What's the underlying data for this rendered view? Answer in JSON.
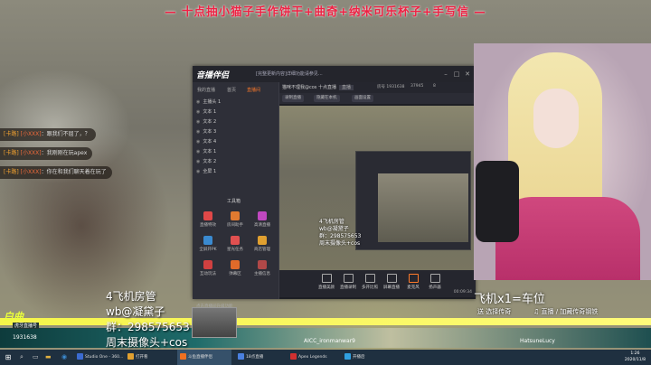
{
  "banner": "— 十点抽小猫子手作饼干+曲奇+纳米可乐杯子+手写信 —",
  "chat": [
    {
      "level": "[卡路]",
      "user": "[小XXX]",
      "sep": "：",
      "msg": "跟我们不屈了，？"
    },
    {
      "level": "[卡路]",
      "user": "[小XXX]",
      "sep": "：",
      "msg": "我刚刚在玩apex"
    },
    {
      "level": "[卡路]",
      "user": "[小XXX]",
      "sep": "：",
      "msg": "你在和我们聊天着在玩了"
    }
  ],
  "window": {
    "logo": "音播伴侣",
    "notice": "[完整更新内容]详细功能请参见...",
    "tabs": [
      "我的直播",
      "首页",
      "直播间"
    ],
    "sources": [
      "主播头 1",
      "文本 1",
      "文本 2",
      "文本 3",
      "文本 4",
      "文本 1",
      "文本 2",
      "全屏 1"
    ],
    "tools_title": "工具箱",
    "tools": [
      "直播特效",
      "房间助手",
      "高清直播",
      "全屏开PK",
      "星光任务",
      "商店管理",
      "互动玩法",
      "弹幕区",
      "主播信息"
    ],
    "bottom_notice": "点击直播间升级功能",
    "info": {
      "title": "猫咪不理我@cos 十点直播",
      "badge": "直播",
      "room": "房号 1931638",
      "fans": "37945",
      "likes": "8"
    },
    "sub_buttons": [
      "录制直播",
      "隐藏在本机",
      "画面设置"
    ],
    "controls": [
      "直播美颜",
      "直播录制",
      "多开比照",
      "屏幕直播",
      "麦克风",
      "扬声器"
    ],
    "status_time": "00:09:34",
    "status_fps": "30fps"
  },
  "cam": {
    "watermark": "飞机x1=车位",
    "line1": "送 选择传奇",
    "line2": "♫ 直播 / 加藏传奇钢铁"
  },
  "room_text": [
    "4飞机房管",
    "wb@凝黛子",
    "群：298575653",
    "周末摄像头+cos"
  ],
  "preview_overlay": [
    "4飞机房管",
    "wb@凝黛子",
    "群：298575653",
    "周末摄像头+cos"
  ],
  "logo": {
    "text": "白曲",
    "sub": "虎牙直播号",
    "room": "1931638"
  },
  "players": [
    "AICC_ironmanwar9",
    "HatsuneLucy"
  ],
  "taskbar": [
    {
      "label": "Studio One - 360...",
      "color": "#3b6bd0"
    },
    {
      "label": "打开看",
      "color": "#e0a030"
    },
    {
      "label": "斗鱼直播伴侣",
      "color": "#f07020"
    },
    {
      "label": "18点直播",
      "color": "#4a80e0"
    },
    {
      "label": "Apex Legends",
      "color": "#d03030"
    },
    {
      "label": "开播后",
      "color": "#30a0e0"
    }
  ],
  "clock": {
    "time": "1:26",
    "date": "2020/11/8"
  },
  "colors": {
    "accent": "#ff7a2a",
    "banner": "#ee2244",
    "yellow": "#f5f54a"
  }
}
